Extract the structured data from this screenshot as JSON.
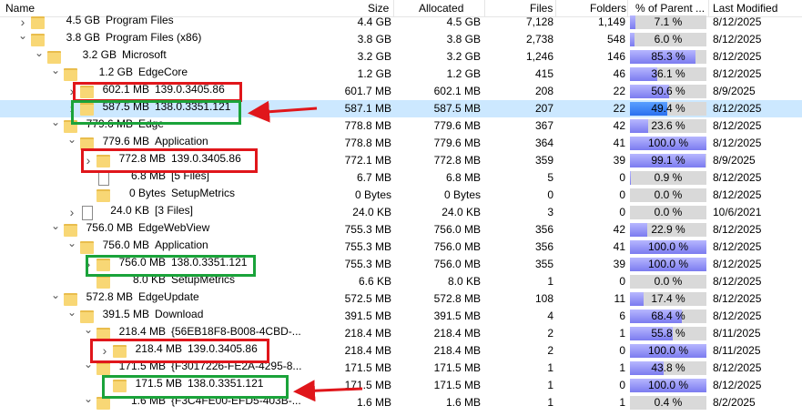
{
  "columns": {
    "name": "Name",
    "size": "Size",
    "allocated": "Allocated",
    "files": "Files",
    "folders": "Folders",
    "percent": "% of Parent ...",
    "modified": "Last Modified"
  },
  "rows": [
    {
      "size_label": "4.5 GB",
      "name": "Program Files",
      "size": "4.4 GB",
      "allocated": "4.5 GB",
      "files": "7,128",
      "folders": "1,149",
      "percent": "7.1 %",
      "pct": 7.1,
      "modified": "8/12/2025",
      "expand": "right",
      "icon": "folder"
    },
    {
      "size_label": "3.8 GB",
      "name": "Program Files (x86)",
      "size": "3.8 GB",
      "allocated": "3.8 GB",
      "files": "2,738",
      "folders": "548",
      "percent": "6.0 %",
      "pct": 6.0,
      "modified": "8/12/2025",
      "expand": "down",
      "icon": "folder"
    },
    {
      "size_label": "3.2 GB",
      "name": "Microsoft",
      "size": "3.2 GB",
      "allocated": "3.2 GB",
      "files": "1,246",
      "folders": "146",
      "percent": "85.3 %",
      "pct": 85.3,
      "modified": "8/12/2025",
      "expand": "down",
      "icon": "folder"
    },
    {
      "size_label": "1.2 GB",
      "name": "EdgeCore",
      "size": "1.2 GB",
      "allocated": "1.2 GB",
      "files": "415",
      "folders": "46",
      "percent": "36.1 %",
      "pct": 36.1,
      "modified": "8/12/2025",
      "expand": "down",
      "icon": "folder"
    },
    {
      "size_label": "602.1 MB",
      "name": "139.0.3405.86",
      "size": "601.7 MB",
      "allocated": "602.1 MB",
      "files": "208",
      "folders": "22",
      "percent": "50.6 %",
      "pct": 50.6,
      "modified": "8/9/2025",
      "expand": "right",
      "icon": "folder"
    },
    {
      "size_label": "587.5 MB",
      "name": "138.0.3351.121",
      "size": "587.1 MB",
      "allocated": "587.5 MB",
      "files": "207",
      "folders": "22",
      "percent": "49.4 %",
      "pct": 49.4,
      "modified": "8/12/2025",
      "expand": "right",
      "icon": "folder",
      "selected": true
    },
    {
      "size_label": "779.6 MB",
      "name": "Edge",
      "size": "778.8 MB",
      "allocated": "779.6 MB",
      "files": "367",
      "folders": "42",
      "percent": "23.6 %",
      "pct": 23.6,
      "modified": "8/12/2025",
      "expand": "down",
      "icon": "folder"
    },
    {
      "size_label": "779.6 MB",
      "name": "Application",
      "size": "778.8 MB",
      "allocated": "779.6 MB",
      "files": "364",
      "folders": "41",
      "percent": "100.0 %",
      "pct": 100,
      "modified": "8/12/2025",
      "expand": "down",
      "icon": "folder"
    },
    {
      "size_label": "772.8 MB",
      "name": "139.0.3405.86",
      "size": "772.1 MB",
      "allocated": "772.8 MB",
      "files": "359",
      "folders": "39",
      "percent": "99.1 %",
      "pct": 99.1,
      "modified": "8/9/2025",
      "expand": "right",
      "icon": "folder"
    },
    {
      "size_label": "6.8 MB",
      "name": "[5 Files]",
      "size": "6.7 MB",
      "allocated": "6.8 MB",
      "files": "5",
      "folders": "0",
      "percent": "0.9 %",
      "pct": 0.9,
      "modified": "8/12/2025",
      "expand": "",
      "icon": "file"
    },
    {
      "size_label": "0 Bytes",
      "name": "SetupMetrics",
      "size": "0 Bytes",
      "allocated": "0 Bytes",
      "files": "0",
      "folders": "0",
      "percent": "0.0 %",
      "pct": 0,
      "modified": "8/12/2025",
      "expand": "",
      "icon": "folder"
    },
    {
      "size_label": "24.0 KB",
      "name": "[3 Files]",
      "size": "24.0 KB",
      "allocated": "24.0 KB",
      "files": "3",
      "folders": "0",
      "percent": "0.0 %",
      "pct": 0,
      "modified": "10/6/2021",
      "expand": "right",
      "icon": "file"
    },
    {
      "size_label": "756.0 MB",
      "name": "EdgeWebView",
      "size": "755.3 MB",
      "allocated": "756.0 MB",
      "files": "356",
      "folders": "42",
      "percent": "22.9 %",
      "pct": 22.9,
      "modified": "8/12/2025",
      "expand": "down",
      "icon": "folder"
    },
    {
      "size_label": "756.0 MB",
      "name": "Application",
      "size": "755.3 MB",
      "allocated": "756.0 MB",
      "files": "356",
      "folders": "41",
      "percent": "100.0 %",
      "pct": 100,
      "modified": "8/12/2025",
      "expand": "down",
      "icon": "folder"
    },
    {
      "size_label": "756.0 MB",
      "name": "138.0.3351.121",
      "size": "755.3 MB",
      "allocated": "756.0 MB",
      "files": "355",
      "folders": "39",
      "percent": "100.0 %",
      "pct": 100,
      "modified": "8/12/2025",
      "expand": "right",
      "icon": "folder"
    },
    {
      "size_label": "8.0 KB",
      "name": "SetupMetrics",
      "size": "6.6 KB",
      "allocated": "8.0 KB",
      "files": "1",
      "folders": "0",
      "percent": "0.0 %",
      "pct": 0,
      "modified": "8/12/2025",
      "expand": "",
      "icon": "folder"
    },
    {
      "size_label": "572.8 MB",
      "name": "EdgeUpdate",
      "size": "572.5 MB",
      "allocated": "572.8 MB",
      "files": "108",
      "folders": "11",
      "percent": "17.4 %",
      "pct": 17.4,
      "modified": "8/12/2025",
      "expand": "down",
      "icon": "folder"
    },
    {
      "size_label": "391.5 MB",
      "name": "Download",
      "size": "391.5 MB",
      "allocated": "391.5 MB",
      "files": "4",
      "folders": "6",
      "percent": "68.4 %",
      "pct": 68.4,
      "modified": "8/12/2025",
      "expand": "down",
      "icon": "folder"
    },
    {
      "size_label": "218.4 MB",
      "name": "{56EB18F8-B008-4CBD-...",
      "size": "218.4 MB",
      "allocated": "218.4 MB",
      "files": "2",
      "folders": "1",
      "percent": "55.8 %",
      "pct": 55.8,
      "modified": "8/11/2025",
      "expand": "down",
      "icon": "folder"
    },
    {
      "size_label": "218.4 MB",
      "name": "139.0.3405.86",
      "size": "218.4 MB",
      "allocated": "218.4 MB",
      "files": "2",
      "folders": "0",
      "percent": "100.0 %",
      "pct": 100,
      "modified": "8/11/2025",
      "expand": "right",
      "icon": "folder"
    },
    {
      "size_label": "171.5 MB",
      "name": "{F3017226-FE2A-4295-8...",
      "size": "171.5 MB",
      "allocated": "171.5 MB",
      "files": "1",
      "folders": "1",
      "percent": "43.8 %",
      "pct": 43.8,
      "modified": "8/12/2025",
      "expand": "down",
      "icon": "folder"
    },
    {
      "size_label": "171.5 MB",
      "name": "138.0.3351.121",
      "size": "171.5 MB",
      "allocated": "171.5 MB",
      "files": "1",
      "folders": "0",
      "percent": "100.0 %",
      "pct": 100,
      "modified": "8/12/2025",
      "expand": "",
      "icon": "folder"
    },
    {
      "size_label": "1.6 MB",
      "name": "{F3C4FE00-EFD5-403B-...",
      "size": "1.6 MB",
      "allocated": "1.6 MB",
      "files": "1",
      "folders": "1",
      "percent": "0.4 %",
      "pct": 0.4,
      "modified": "8/2/2025",
      "expand": "down",
      "icon": "folder"
    }
  ],
  "annotations": {
    "red_color": "#e0161b",
    "green_color": "#1aa33a",
    "arrow_color": "#e0161b"
  }
}
